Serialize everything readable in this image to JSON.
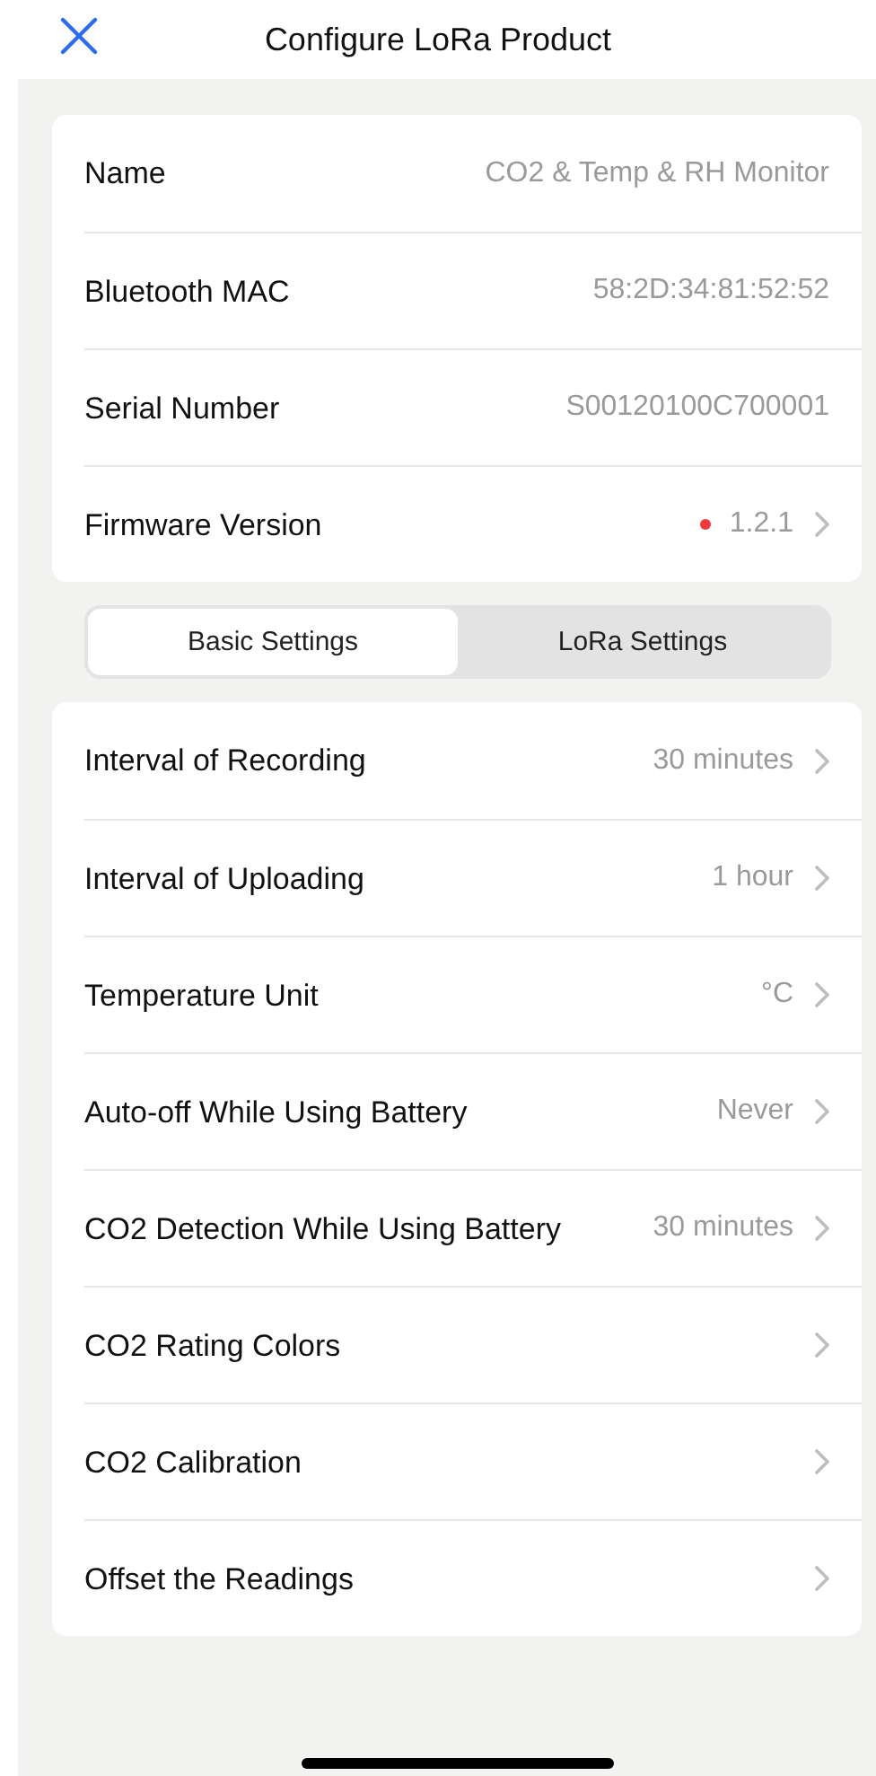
{
  "header": {
    "title": "Configure LoRa Product"
  },
  "info_rows": [
    {
      "label": "Name",
      "value": "CO2 & Temp & RH Monitor",
      "chevron": false,
      "alert_dot": false
    },
    {
      "label": "Bluetooth MAC",
      "value": "58:2D:34:81:52:52",
      "chevron": false,
      "alert_dot": false
    },
    {
      "label": "Serial Number",
      "value": "S00120100C700001",
      "chevron": false,
      "alert_dot": false
    },
    {
      "label": "Firmware Version",
      "value": "1.2.1",
      "chevron": true,
      "alert_dot": true
    }
  ],
  "tabs": [
    {
      "label": "Basic Settings",
      "selected": true
    },
    {
      "label": "LoRa Settings",
      "selected": false
    }
  ],
  "settings_rows": [
    {
      "label": "Interval of Recording",
      "value": "30 minutes"
    },
    {
      "label": "Interval of Uploading",
      "value": "1 hour"
    },
    {
      "label": "Temperature Unit",
      "value": "°C"
    },
    {
      "label": "Auto-off While Using Battery",
      "value": "Never"
    },
    {
      "label": "CO2 Detection While Using Battery",
      "value": "30 minutes"
    },
    {
      "label": "CO2 Rating Colors"
    },
    {
      "label": "CO2 Calibration"
    },
    {
      "label": "Offset the Readings"
    }
  ]
}
